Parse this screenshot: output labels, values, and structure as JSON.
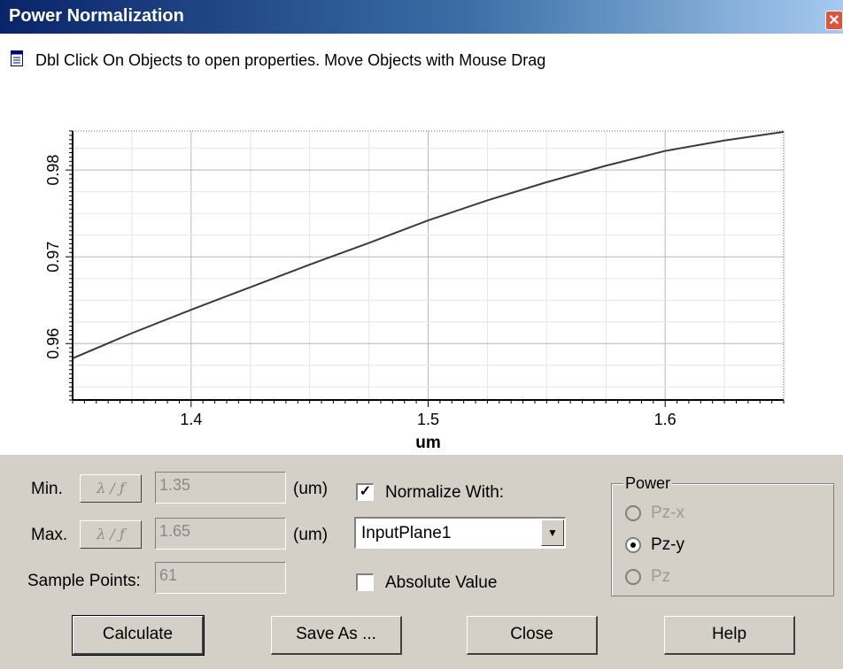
{
  "window": {
    "title": "Power Normalization",
    "close_glyph": "✕"
  },
  "hint": "Dbl Click On Objects to open properties.  Move Objects with Mouse Drag",
  "chart_data": {
    "type": "line",
    "xlabel": "um",
    "ylabel": "",
    "xlim": [
      1.35,
      1.65
    ],
    "ylim": [
      0.9535,
      0.9845
    ],
    "x_ticks": [
      1.4,
      1.5,
      1.6
    ],
    "y_ticks": [
      0.96,
      0.97,
      0.98
    ],
    "x_tick_labels": [
      "1.4",
      "1.5",
      "1.6"
    ],
    "y_tick_labels": [
      "0.96",
      "0.97",
      "0.98"
    ],
    "grid": true,
    "series": [
      {
        "x": [
          1.35,
          1.375,
          1.4,
          1.425,
          1.45,
          1.475,
          1.5,
          1.525,
          1.55,
          1.575,
          1.6,
          1.625,
          1.65
        ],
        "y": [
          0.9583,
          0.9612,
          0.9639,
          0.9665,
          0.9691,
          0.9716,
          0.9742,
          0.9765,
          0.9786,
          0.9805,
          0.9822,
          0.9834,
          0.9844
        ]
      }
    ]
  },
  "controls": {
    "min_label": "Min.",
    "max_label": "Max.",
    "lambda_label": "λ / ƒ",
    "min_value": "1.35",
    "max_value": "1.65",
    "unit_label": "(um)",
    "sample_points_label": "Sample Points:",
    "sample_points_value": "61",
    "normalize_label": "Normalize With:",
    "normalize_checked": "✓",
    "normalize_selected": "InputPlane1",
    "dropdown_arrow": "▼",
    "absolute_label": "Absolute Value"
  },
  "power": {
    "title": "Power",
    "options": [
      "Pz-x",
      "Pz-y",
      "Pz"
    ],
    "selected": "Pz-y"
  },
  "buttons": {
    "calculate": "Calculate",
    "save_as": "Save As ...",
    "close": "Close",
    "help": "Help"
  }
}
